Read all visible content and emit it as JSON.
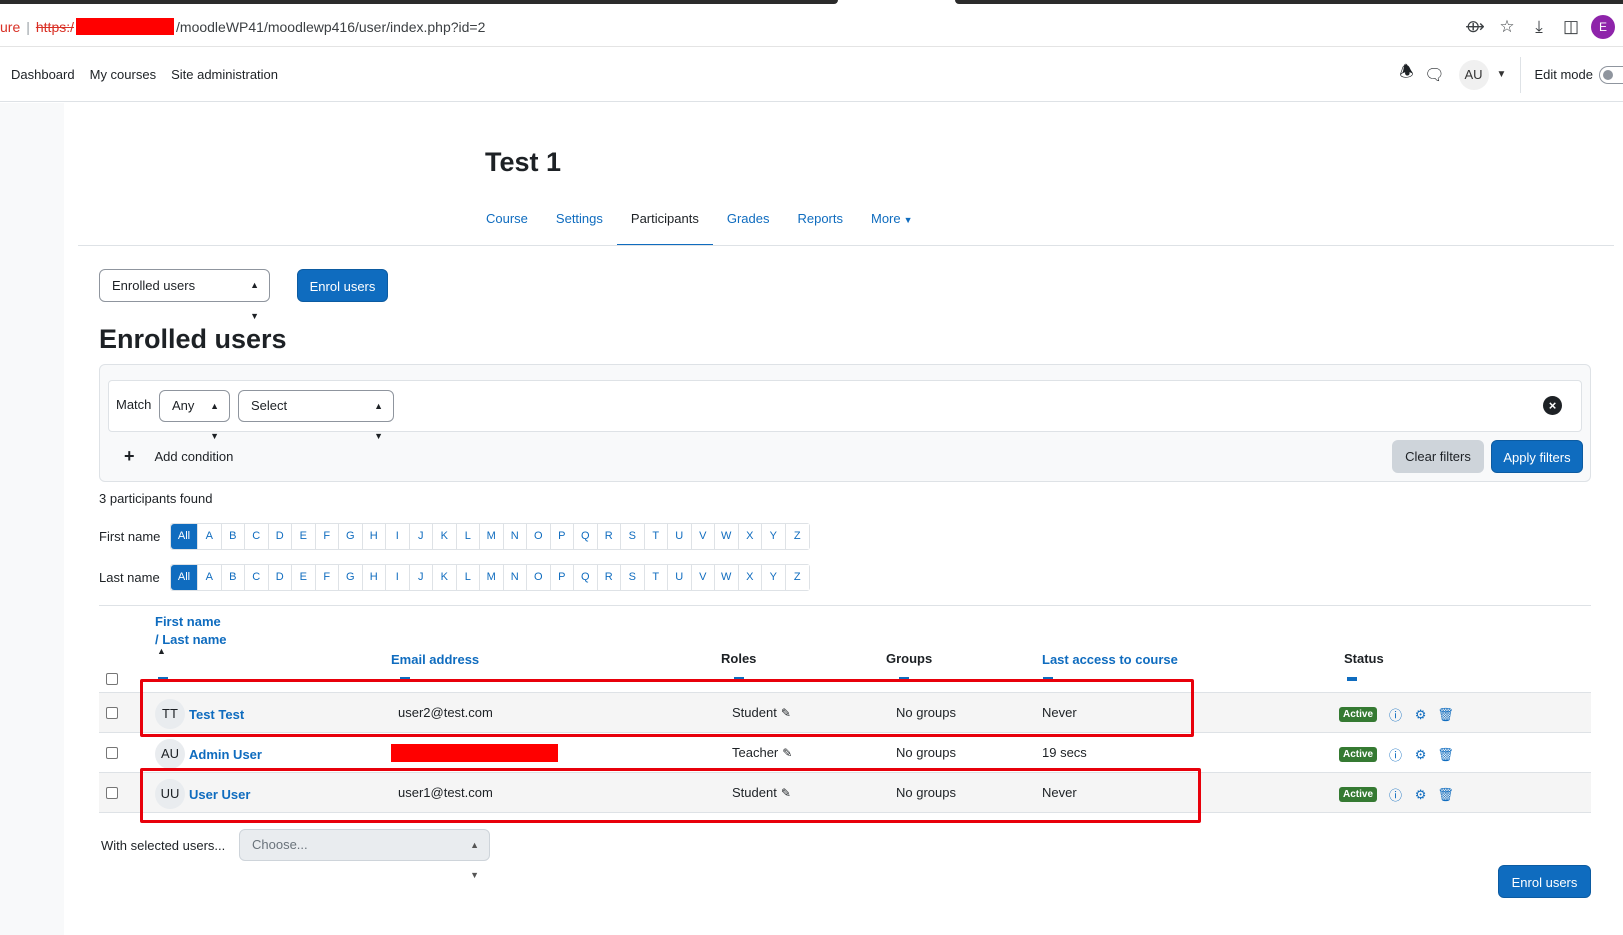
{
  "browser": {
    "url_prefix": "ure",
    "url_scheme": "https:/",
    "url_path": "/moodleWP41/moodlewp416/user/index.php?id=2",
    "profile_initial": "E"
  },
  "navbar": {
    "links": [
      "Dashboard",
      "My courses",
      "Site administration"
    ],
    "user_initials": "AU",
    "edit_mode_label": "Edit mode"
  },
  "course": {
    "title": "Test 1",
    "tabs": [
      "Course",
      "Settings",
      "Participants",
      "Grades",
      "Reports",
      "More"
    ],
    "active_tab": "Participants"
  },
  "controls": {
    "enrolled_select": "Enrolled users",
    "enrol_button": "Enrol users",
    "heading": "Enrolled users"
  },
  "filters": {
    "match_label": "Match",
    "match_value": "Any",
    "type_value": "Select",
    "add_condition": "Add condition",
    "clear_label": "Clear filters",
    "apply_label": "Apply filters"
  },
  "participants_found": "3 participants found",
  "initials": {
    "first_label": "First name",
    "last_label": "Last name",
    "all": "All",
    "letters": [
      "A",
      "B",
      "C",
      "D",
      "E",
      "F",
      "G",
      "H",
      "I",
      "J",
      "K",
      "L",
      "M",
      "N",
      "O",
      "P",
      "Q",
      "R",
      "S",
      "T",
      "U",
      "V",
      "W",
      "X",
      "Y",
      "Z"
    ]
  },
  "table": {
    "headers": {
      "first_name": "First name",
      "last_name": "/ Last name",
      "email": "Email address",
      "roles": "Roles",
      "groups": "Groups",
      "last_access": "Last access to course",
      "status": "Status"
    },
    "rows": [
      {
        "initials": "TT",
        "name": "Test Test",
        "email": "user2@test.com",
        "role": "Student",
        "groups": "No groups",
        "last_access": "Never",
        "status": "Active"
      },
      {
        "initials": "AU",
        "name": "Admin User",
        "email": "",
        "role": "Teacher",
        "groups": "No groups",
        "last_access": "19 secs",
        "status": "Active"
      },
      {
        "initials": "UU",
        "name": "User User",
        "email": "user1@test.com",
        "role": "Student",
        "groups": "No groups",
        "last_access": "Never",
        "status": "Active"
      }
    ]
  },
  "bulk": {
    "with_selected": "With selected users...",
    "choose_placeholder": "Choose..."
  },
  "colors": {
    "primary": "#0f6cbf",
    "active_badge": "#357a32",
    "highlight": "#e8000b"
  }
}
